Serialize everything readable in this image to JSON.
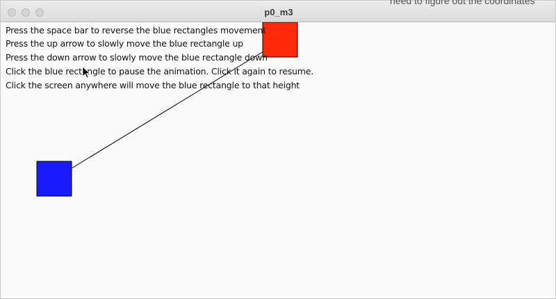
{
  "window": {
    "title": "p0_m3",
    "background_overflow_text": "need to figure out the coordinates"
  },
  "instructions": [
    "Press the space bar to reverse the blue rectangles movement",
    "Press the up arrow to slowly move the blue rectangle up",
    "Press the down arrow to slowly move the blue rectangle down",
    "Click the blue rectangle to pause the animation. Click it again to resume.",
    "Click the screen anywhere will move the blue rectangle to that height"
  ],
  "colors": {
    "blue_rect": "#1a1aff",
    "red_rect": "#ff2a0a",
    "line": "#000000"
  }
}
